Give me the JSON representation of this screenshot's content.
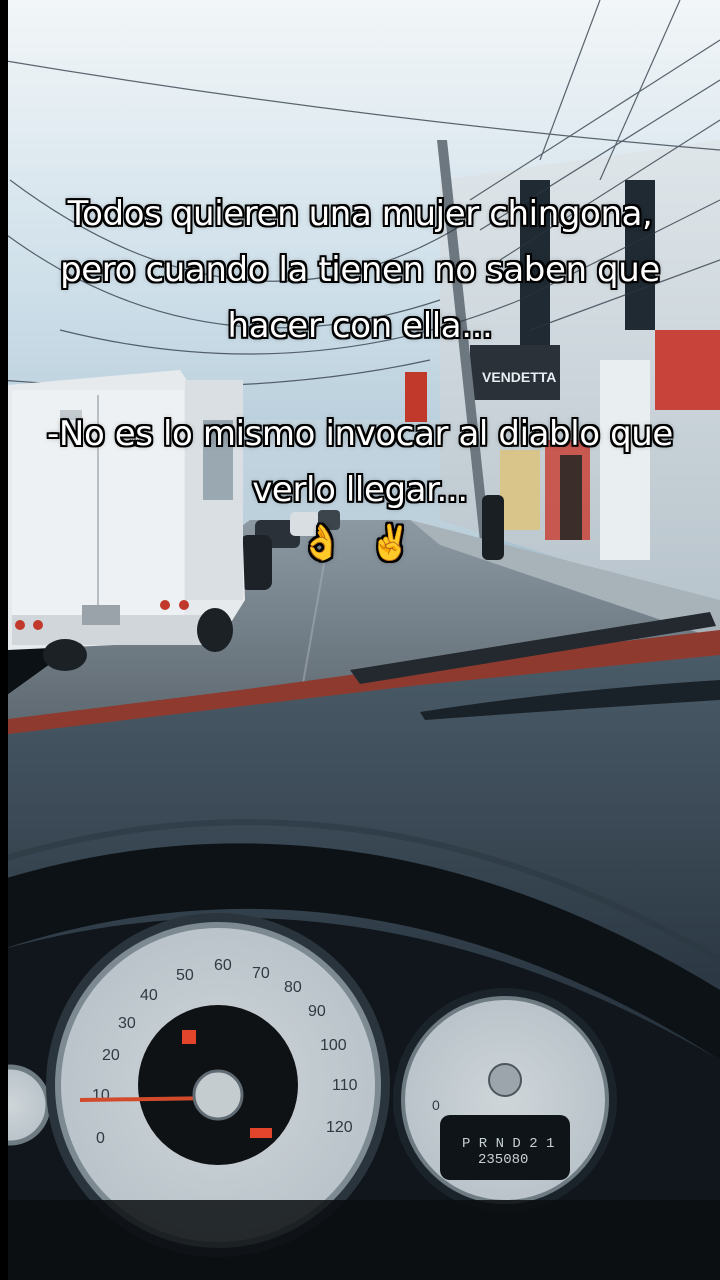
{
  "overlay": {
    "line1": "Todos quieren una mujer chingona,",
    "line2": "pero cuando la tienen no saben que",
    "line3": "hacer con ella...",
    "line4": "-No es lo mismo invocar al diablo que",
    "line5": "verlo llegar...",
    "emojis": "👌 ✌️"
  },
  "scene": {
    "storefront_sign": "VENDETTA",
    "gear_indicator": "P R N D 2 1",
    "odometer": "235080",
    "speed_ticks": [
      "0",
      "10",
      "20",
      "30",
      "40",
      "50",
      "60",
      "70",
      "80",
      "90",
      "100",
      "110",
      "120"
    ]
  }
}
